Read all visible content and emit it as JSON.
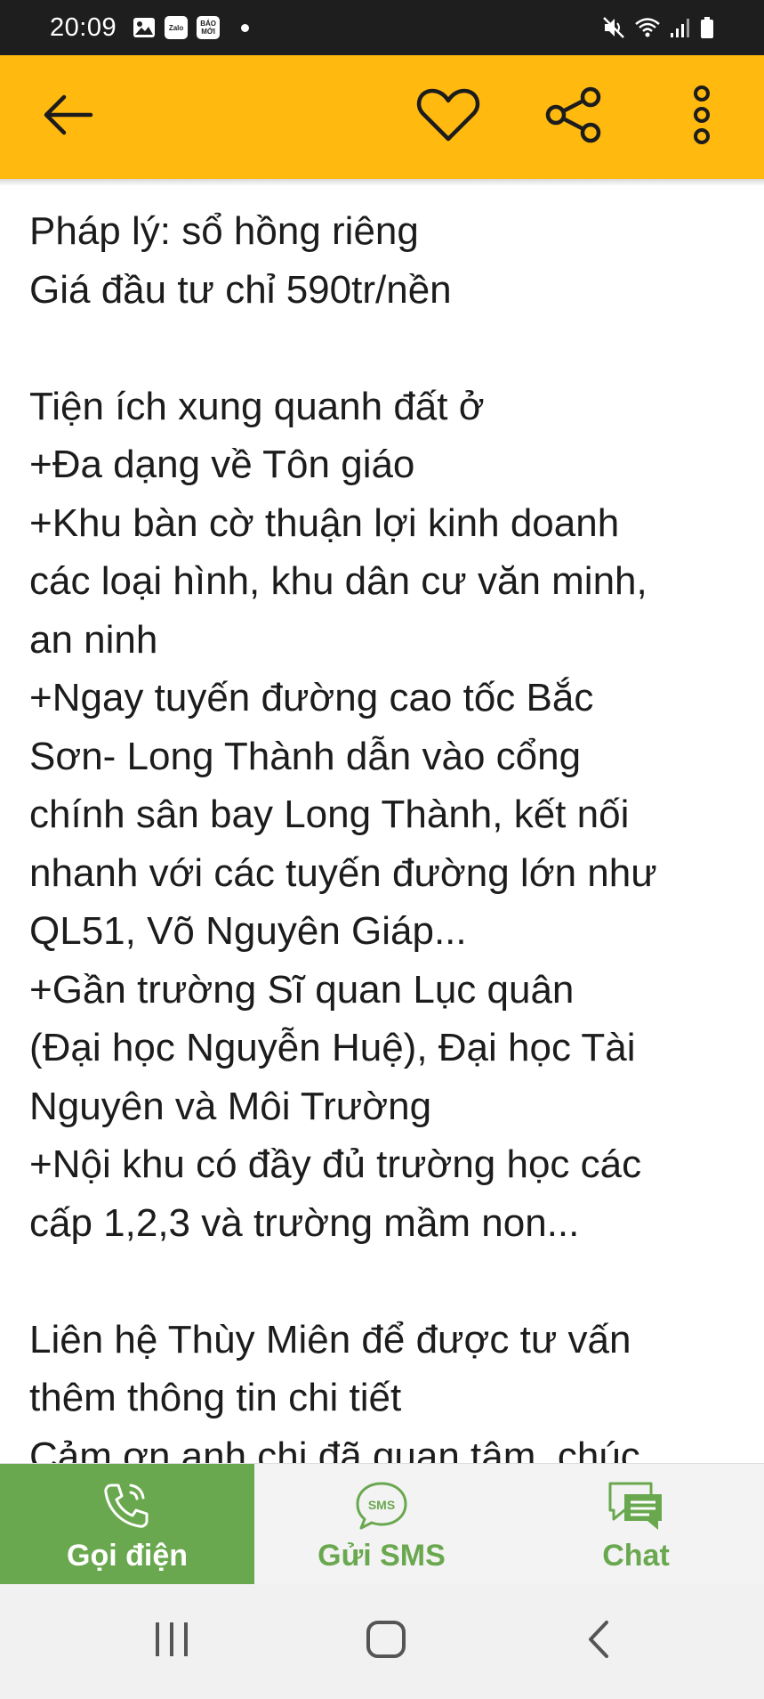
{
  "status_bar": {
    "time": "20:09",
    "left_icons": [
      "gallery-icon",
      "zalo-icon",
      "baomoi-icon",
      "notification-dot"
    ],
    "baomoi_text": "BÁO MỚI",
    "zalo_text": "Zalo",
    "right_icons": [
      "mute-icon",
      "wifi-icon",
      "signal-icon",
      "battery-icon"
    ]
  },
  "app_bar": {
    "color": "#ffb90f",
    "icons": [
      "back-arrow-icon",
      "heart-icon",
      "share-icon",
      "more-vert-icon"
    ]
  },
  "content": {
    "lines": [
      "Pháp lý: sổ hồng riêng",
      "Giá đầu tư chỉ 590tr/nền",
      "",
      "Tiện ích xung quanh đất ở",
      "+Đa dạng về Tôn giáo",
      "+Khu bàn cờ thuận lợi kinh doanh",
      "các loại hình, khu dân cư văn minh,",
      "an ninh",
      "+Ngay tuyến đường cao tốc Bắc",
      "Sơn- Long Thành dẫn vào cổng",
      "chính sân bay Long Thành, kết nối",
      "nhanh với các tuyến đường lớn như",
      "QL51, Võ Nguyên Giáp...",
      "+Gần trường Sĩ quan Lục quân",
      "(Đại học Nguyễn Huệ), Đại học Tài",
      "Nguyên và Môi Trường",
      "+Nội khu có đầy đủ trường học các",
      "cấp 1,2,3 và trường mầm non...",
      "",
      "Liên hệ Thùy Miên để được tư vấn",
      "thêm thông tin chi tiết",
      "Cảm ơn anh chị đã quan tâm, chúc"
    ]
  },
  "actions": {
    "call_label": "Gọi điện",
    "sms_label": "Gửi SMS",
    "sms_icon_text": "SMS",
    "chat_label": "Chat",
    "accent_color": "#6aa84f"
  },
  "nav_bar": {
    "icons": [
      "recent-apps-icon",
      "home-icon",
      "back-icon"
    ]
  }
}
